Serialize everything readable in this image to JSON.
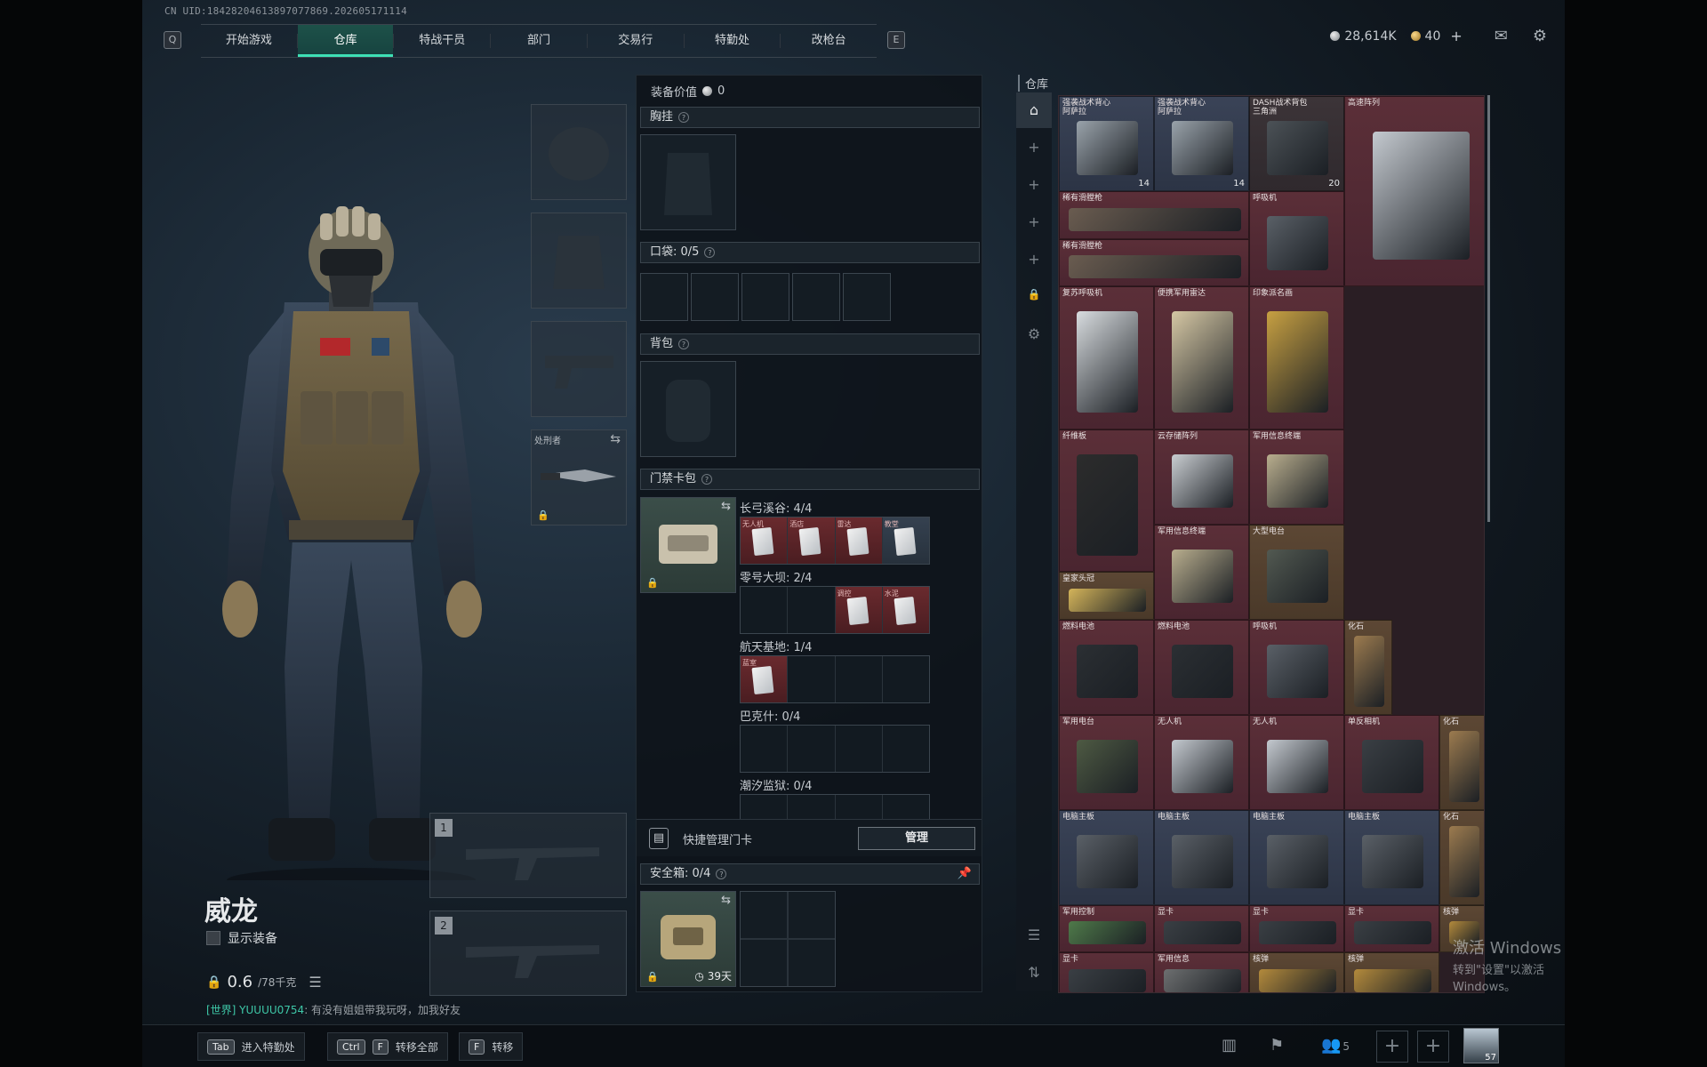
{
  "uid": "CN UID:18428204613897077869.202605171114",
  "nav": {
    "left_key": "Q",
    "right_key": "E",
    "tabs": [
      {
        "label": "开始游戏",
        "active": false,
        "alert": false
      },
      {
        "label": "仓库",
        "active": true,
        "alert": false
      },
      {
        "label": "特战干员",
        "active": false,
        "alert": false
      },
      {
        "label": "部门",
        "active": false,
        "alert": false
      },
      {
        "label": "交易行",
        "active": false,
        "alert": true
      },
      {
        "label": "特勤处",
        "active": false,
        "alert": false
      },
      {
        "label": "改枪台",
        "active": false,
        "alert": true
      }
    ],
    "alert_mark": "!"
  },
  "currency": {
    "silver": "28,614K",
    "gold": "40",
    "add": "+"
  },
  "character": {
    "name": "威龙",
    "show_equip_label": "显示装备",
    "weight": "0.6",
    "weight_max": "/78千克"
  },
  "equip_slots": {
    "melee_label": "处刑者",
    "primary_num": "1",
    "secondary_num": "2"
  },
  "chat": {
    "channel": "[世界] YUUUU0754",
    "message": ": 有没有姐姐带我玩呀，加我好友"
  },
  "loadout": {
    "value_label": "装备价值",
    "value": "0",
    "chest_label": "胸挂",
    "pockets_label": "口袋: 0/5",
    "backpack_label": "背包",
    "keycard_label": "门禁卡包",
    "zones": [
      {
        "label": "长弓溪谷: 4/4",
        "cards": [
          "无人机",
          "酒店",
          "雷达",
          "教堂"
        ]
      },
      {
        "label": "零号大坝: 2/4",
        "cards": [
          "",
          "",
          "调控",
          "水泥"
        ]
      },
      {
        "label": "航天基地: 1/4",
        "cards": [
          "蓝室",
          "",
          "",
          ""
        ]
      },
      {
        "label": "巴克什: 0/4",
        "cards": [
          "",
          "",
          "",
          ""
        ]
      },
      {
        "label": "潮汐监狱: 0/4",
        "cards": [
          "",
          "",
          "",
          ""
        ]
      }
    ],
    "quick_manage_label": "快捷管理门卡",
    "manage_button": "管理",
    "safebox_label": "安全箱: 0/4",
    "safebox_days": "39天"
  },
  "warehouse": {
    "title": "仓库",
    "items": [
      {
        "name": "强袭战术背心\n阿萨拉",
        "stack": "14",
        "tone": "blue"
      },
      {
        "name": "强袭战术背心\n阿萨拉",
        "stack": "14",
        "tone": "blue"
      },
      {
        "name": "DASH战术背包\n三角洲",
        "stack": "20",
        "tone": "dark"
      },
      {
        "name": "高速阵列",
        "stack": "",
        "tone": "red"
      },
      {
        "name": "稀有滑膛枪",
        "stack": "",
        "tone": "red"
      },
      {
        "name": "呼吸机",
        "stack": "",
        "tone": "red"
      },
      {
        "name": "稀有滑膛枪",
        "stack": "",
        "tone": "red"
      },
      {
        "name": "复苏呼吸机",
        "stack": "",
        "tone": "red"
      },
      {
        "name": "便携军用雷达",
        "stack": "",
        "tone": "red"
      },
      {
        "name": "印象派名画",
        "stack": "",
        "tone": "red"
      },
      {
        "name": "纤维板",
        "stack": "",
        "tone": "red"
      },
      {
        "name": "云存储阵列",
        "stack": "",
        "tone": "red"
      },
      {
        "name": "军用信息终端",
        "stack": "",
        "tone": "red"
      },
      {
        "name": "军用信息终端",
        "stack": "",
        "tone": "red"
      },
      {
        "name": "大型电台",
        "stack": "",
        "tone": "gold"
      },
      {
        "name": "皇家头冠",
        "stack": "",
        "tone": "gold"
      },
      {
        "name": "燃料电池",
        "stack": "",
        "tone": "red"
      },
      {
        "name": "燃料电池",
        "stack": "",
        "tone": "red"
      },
      {
        "name": "呼吸机",
        "stack": "",
        "tone": "red"
      },
      {
        "name": "化石",
        "stack": "",
        "tone": "gold"
      },
      {
        "name": "军用电台",
        "stack": "",
        "tone": "red"
      },
      {
        "name": "无人机",
        "stack": "",
        "tone": "red"
      },
      {
        "name": "无人机",
        "stack": "",
        "tone": "red"
      },
      {
        "name": "单反相机",
        "stack": "",
        "tone": "red"
      },
      {
        "name": "化石",
        "stack": "",
        "tone": "gold"
      },
      {
        "name": "电脑主板",
        "stack": "",
        "tone": "blue"
      },
      {
        "name": "电脑主板",
        "stack": "",
        "tone": "blue"
      },
      {
        "name": "电脑主板",
        "stack": "",
        "tone": "blue"
      },
      {
        "name": "电脑主板",
        "stack": "",
        "tone": "blue"
      },
      {
        "name": "化石",
        "stack": "",
        "tone": "gold"
      },
      {
        "name": "军用控制",
        "stack": "",
        "tone": "red"
      },
      {
        "name": "显卡",
        "stack": "",
        "tone": "red"
      },
      {
        "name": "显卡",
        "stack": "",
        "tone": "red"
      },
      {
        "name": "显卡",
        "stack": "",
        "tone": "red"
      },
      {
        "name": "核弹",
        "stack": "",
        "tone": "gold"
      },
      {
        "name": "显卡",
        "stack": "",
        "tone": "red"
      },
      {
        "name": "军用信息",
        "stack": "",
        "tone": "red"
      },
      {
        "name": "核弹",
        "stack": "",
        "tone": "gold"
      },
      {
        "name": "核弹",
        "stack": "",
        "tone": "gold"
      }
    ]
  },
  "windows_activation": {
    "line1": "激活 Windows",
    "line2": "转到\"设置\"以激活 Windows。"
  },
  "bottom_bar": {
    "hints": [
      {
        "keys": [
          "Tab"
        ],
        "label": "进入特勤处"
      },
      {
        "keys": [
          "Ctrl",
          "F"
        ],
        "label": "转移全部"
      },
      {
        "keys": [
          "F"
        ],
        "label": "转移"
      }
    ],
    "friends_count": "5",
    "avatar_level": "57"
  }
}
